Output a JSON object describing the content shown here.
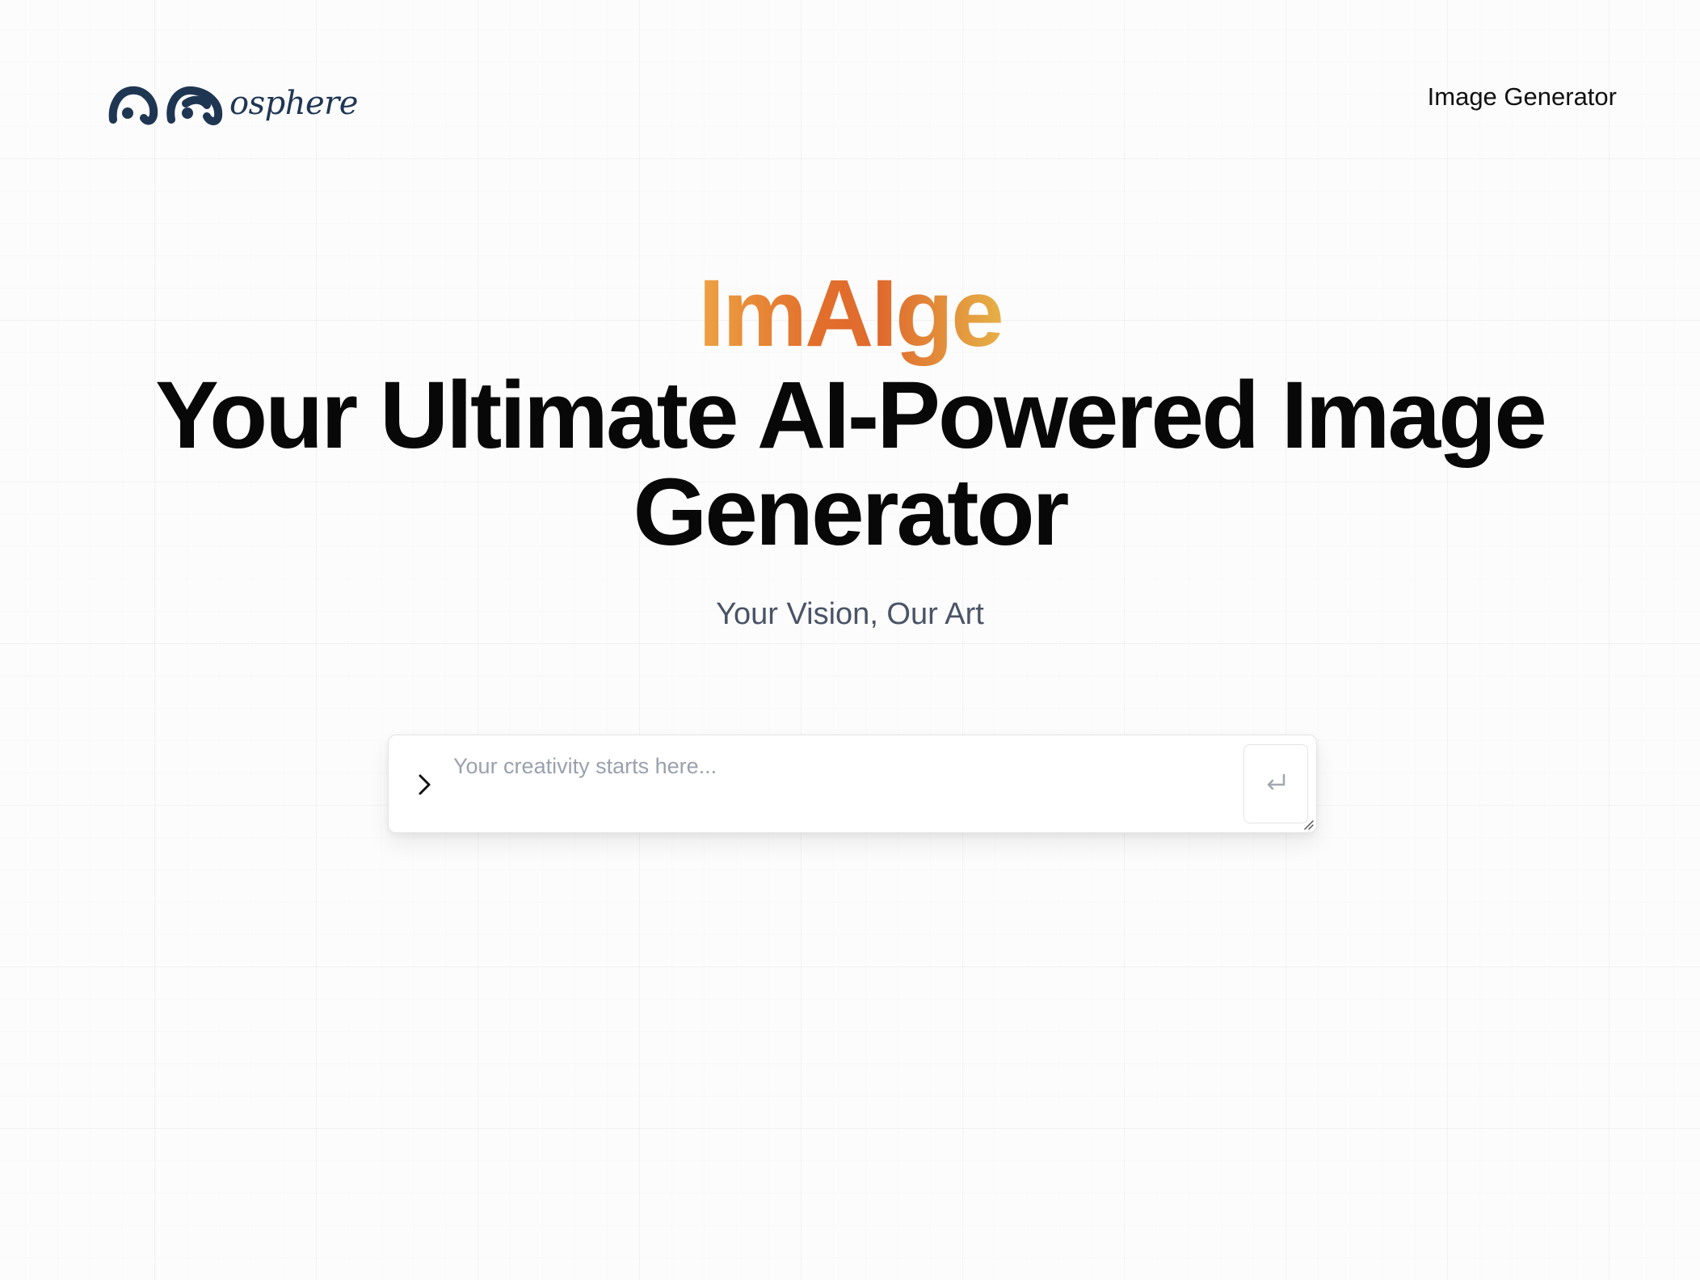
{
  "header": {
    "logo_text": "osphere",
    "nav_link_label": "Image Generator"
  },
  "hero": {
    "brand": "ImAIge",
    "headline": "Your Ultimate AI-Powered Image Generator",
    "tagline": "Your Vision, Our Art"
  },
  "prompt": {
    "placeholder": "Your creativity starts here...",
    "value": ""
  },
  "icons": {
    "prompt_prefix": "chevron-right-icon",
    "submit": "enter-return-icon",
    "resize": "resize-handle-icon"
  },
  "colors": {
    "logo": "#1f3653",
    "brand_gradient": [
      "#eda344",
      "#e26f2b",
      "#df6a2e",
      "#e6b046"
    ],
    "headline": "#080808",
    "tagline": "#4a5466",
    "placeholder": "#9aa1ad"
  }
}
